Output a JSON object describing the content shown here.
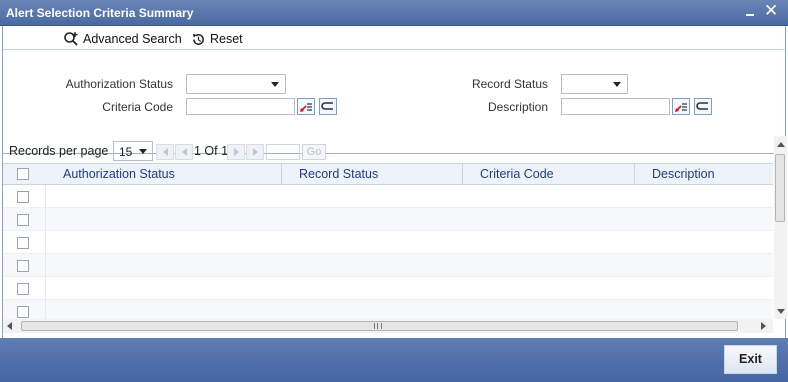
{
  "window": {
    "title": "Alert Selection Criteria Summary"
  },
  "toolbar": {
    "advanced_search_label": "Advanced Search",
    "reset_label": "Reset"
  },
  "criteria": {
    "authorization_status_label": "Authorization Status",
    "authorization_status_value": "",
    "record_status_label": "Record Status",
    "record_status_value": "",
    "criteria_code_label": "Criteria Code",
    "criteria_code_value": "",
    "description_label": "Description",
    "description_value": ""
  },
  "pager": {
    "records_per_page_label": "Records per page",
    "records_per_page_value": "15",
    "page_info": "1 Of 1",
    "goto_value": "",
    "go_label": "Go"
  },
  "grid": {
    "columns": [
      "Authorization Status",
      "Record Status",
      "Criteria Code",
      "Description"
    ],
    "visible_empty_rows": 6
  },
  "footer": {
    "exit_label": "Exit"
  },
  "colors": {
    "titlebar": "#5a78ad",
    "header_text": "#1f3c8a",
    "footer": "#5272aa"
  }
}
